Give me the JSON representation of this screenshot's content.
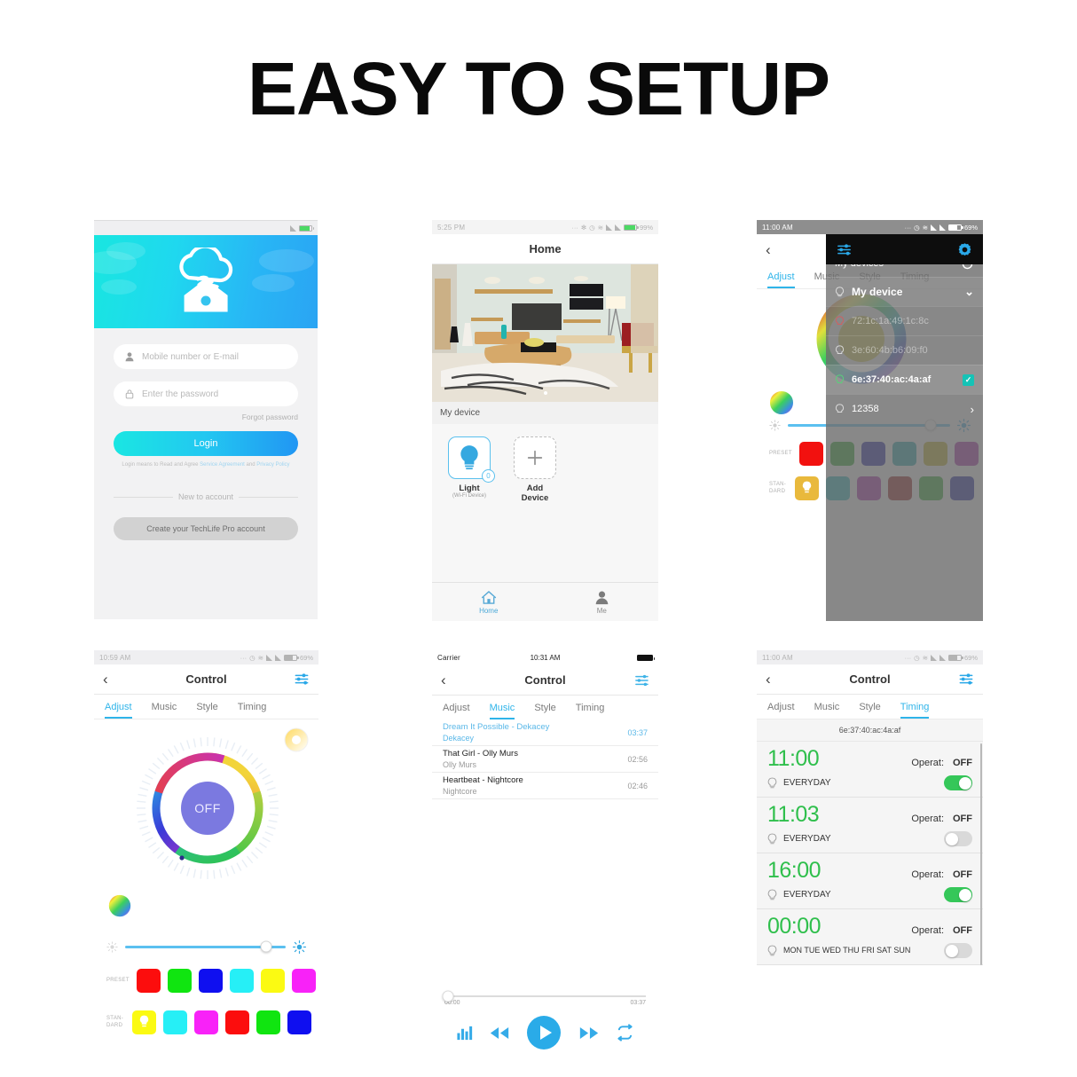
{
  "page": {
    "title": "EASY TO SETUP"
  },
  "colors": {
    "accent": "#2fb4e9",
    "green": "#2fbf4c",
    "toggle_on": "#35c759",
    "check_teal": "#15c3b6"
  },
  "login_screen": {
    "statusbar": {
      "time": "",
      "battery": ""
    },
    "hero_icon": "cloud-home-wifi-icon",
    "username_field": {
      "placeholder": "Mobile number or E-mail",
      "value": "",
      "icon": "user-icon"
    },
    "password_field": {
      "placeholder": "Enter the password",
      "value": "",
      "icon": "lock-icon"
    },
    "forgot_label": "Forgot password",
    "login_label": "Login",
    "agreement_prefix": "Login means to Read and Agree",
    "agreement_service": "Service Agreement",
    "agreement_and": "and",
    "agreement_privacy": "Privacy Policy",
    "divider_label": "New to account",
    "create_label": "Create your TechLife Pro account"
  },
  "home_screen": {
    "statusbar": {
      "time": "5:25 PM",
      "battery": "99%"
    },
    "title": "Home",
    "section_label": "My device",
    "devices": [
      {
        "name": "Light",
        "sub": "(Wi-Fi Device)",
        "badge": "0",
        "icon": "bulb-icon"
      },
      {
        "name": "Add Device",
        "sub": "",
        "badge": "",
        "icon": "plus-icon"
      }
    ],
    "tabbar": [
      {
        "label": "Home",
        "icon": "home-icon",
        "active": true
      },
      {
        "label": "Me",
        "icon": "person-icon",
        "active": false
      }
    ]
  },
  "devicelist_screen": {
    "statusbar": {
      "time": "11:00 AM",
      "battery": "69%"
    },
    "toolbar": {
      "sliders_icon": "sliders-icon",
      "gear_icon": "gear-icon"
    },
    "tabs": [
      {
        "label": "Adjust",
        "active": true
      },
      {
        "label": "Music",
        "active": false
      },
      {
        "label": "Style",
        "active": false
      },
      {
        "label": "Timing",
        "active": false
      }
    ],
    "overlay": {
      "title": "My devices",
      "refresh_icon": "refresh-icon",
      "group": {
        "label": "My device",
        "chevron": "chevron-down-icon"
      },
      "items": [
        {
          "label": "72:1c:1a:49:1c:8c",
          "state": "dim",
          "trailing": ""
        },
        {
          "label": "3e:60:4b:b6:09:f0",
          "state": "dim",
          "trailing": ""
        },
        {
          "label": "6e:37:40:ac:4a:af",
          "state": "selected",
          "trailing": "checkbox"
        },
        {
          "label": "12358",
          "state": "normal",
          "trailing": "chevron-right"
        }
      ]
    },
    "presets": {
      "preset_label": "PRESET",
      "standard_label": "STAN-\nDARD",
      "preset_colors": [
        "#f2110f",
        "#19a019",
        "#0b0b9e",
        "#129fa6",
        "#bdaa15",
        "#a319a3"
      ],
      "standard_colors": [
        "#e9b93c",
        "#1ab6bd",
        "#a619a6",
        "#911010",
        "#1da41d",
        "#10119b"
      ]
    }
  },
  "adjust_screen": {
    "statusbar": {
      "time": "10:59 AM",
      "battery": "69%"
    },
    "title": "Control",
    "back_icon": "back-chevron-icon",
    "menu_icon": "sliders-icon",
    "tabs": [
      {
        "label": "Adjust",
        "active": true
      },
      {
        "label": "Music",
        "active": false
      },
      {
        "label": "Style",
        "active": false
      },
      {
        "label": "Timing",
        "active": false
      }
    ],
    "power_button_label": "OFF",
    "warm_wheel_icon": "warm-white-wheel-icon",
    "color_wheel_icon": "color-wheel-icon",
    "brightness": {
      "value": 88,
      "low_icon": "brightness-low-icon",
      "high_icon": "brightness-high-icon"
    },
    "preset_label": "PRESET",
    "standard_label": "STAN-\nDARD",
    "preset_colors": [
      "#fc0d0d",
      "#10e510",
      "#0f0ff0",
      "#26eff6",
      "#fbfa12",
      "#f822f8"
    ],
    "standard_colors": [
      "#fbfa12",
      "#26eff6",
      "#f822f8",
      "#fc0d0d",
      "#10e510",
      "#0f0ff0"
    ]
  },
  "music_screen": {
    "statusbar": {
      "carrier": "Carrier",
      "time": "10:31 AM",
      "wifi_icon": "wifi-icon"
    },
    "title": "Control",
    "back_icon": "back-chevron-icon",
    "menu_icon": "sliders-icon",
    "tabs": [
      {
        "label": "Adjust",
        "active": false
      },
      {
        "label": "Music",
        "active": true
      },
      {
        "label": "Style",
        "active": false
      },
      {
        "label": "Timing",
        "active": false
      }
    ],
    "songs": [
      {
        "title": "Dream It Possible - Dekacey",
        "artist": "Dekacey",
        "duration": "03:37",
        "playing": true
      },
      {
        "title": "That Girl - Olly Murs",
        "artist": "Olly Murs",
        "duration": "02:56",
        "playing": false
      },
      {
        "title": "Heartbeat - Nightcore",
        "artist": "Nightcore",
        "duration": "02:46",
        "playing": false
      }
    ],
    "player": {
      "elapsed": "00:00",
      "total": "03:37",
      "progress": 0,
      "controls": [
        {
          "icon": "equalizer-icon"
        },
        {
          "icon": "rewind-icon"
        },
        {
          "icon": "play-icon"
        },
        {
          "icon": "fast-forward-icon"
        },
        {
          "icon": "repeat-icon"
        }
      ]
    }
  },
  "timing_screen": {
    "statusbar": {
      "time": "11:00 AM",
      "battery": "69%"
    },
    "title": "Control",
    "back_icon": "back-chevron-icon",
    "menu_icon": "sliders-icon",
    "tabs": [
      {
        "label": "Adjust",
        "active": false
      },
      {
        "label": "Music",
        "active": false
      },
      {
        "label": "Style",
        "active": false
      },
      {
        "label": "Timing",
        "active": true
      }
    ],
    "device_mac": "6e:37:40:ac:4a:af",
    "timers": [
      {
        "time": "11:00",
        "operat_label": "Operat:",
        "operat_value": "OFF",
        "repeat": "EVERYDAY",
        "enabled": true
      },
      {
        "time": "11:03",
        "operat_label": "Operat:",
        "operat_value": "OFF",
        "repeat": "EVERYDAY",
        "enabled": false
      },
      {
        "time": "16:00",
        "operat_label": "Operat:",
        "operat_value": "OFF",
        "repeat": "EVERYDAY",
        "enabled": true
      },
      {
        "time": "00:00",
        "operat_label": "Operat:",
        "operat_value": "OFF",
        "repeat": "MON TUE WED THU FRI SAT SUN",
        "enabled": false
      }
    ]
  }
}
